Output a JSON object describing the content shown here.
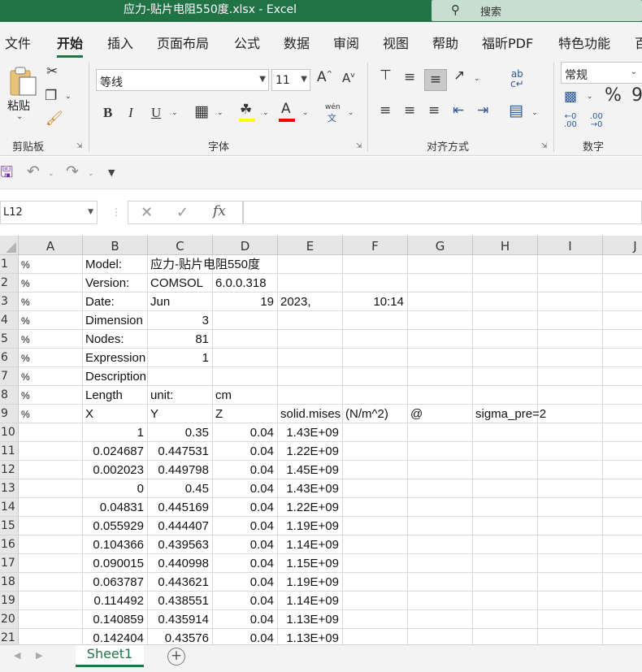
{
  "title": "应力-贴片电阻550度.xlsx  -  Excel",
  "search_placeholder": "搜索",
  "tabs": [
    "文件",
    "开始",
    "插入",
    "页面布局",
    "公式",
    "数据",
    "审阅",
    "视图",
    "帮助",
    "福昕PDF",
    "特色功能",
    "百"
  ],
  "ribbon": {
    "clipboard": {
      "label": "剪贴板",
      "paste": "粘贴"
    },
    "font": {
      "label": "字体",
      "font_name": "等线",
      "font_size": "11",
      "bold": "B",
      "italic": "I",
      "underline": "U",
      "phonetic_top": "wén",
      "phonetic_bottom": "文"
    },
    "alignment": {
      "label": "对齐方式"
    },
    "number": {
      "label": "数字",
      "format": "常规"
    }
  },
  "name_box": "L12",
  "formula_content": "",
  "columns": [
    "A",
    "B",
    "C",
    "D",
    "E",
    "F",
    "G",
    "H",
    "I",
    "J"
  ],
  "rows": [
    {
      "n": "1",
      "cells": {
        "A": "%",
        "B": "Model:",
        "C": "应力-贴片电阻550度"
      }
    },
    {
      "n": "2",
      "cells": {
        "A": "%",
        "B": "Version:",
        "C": "COMSOL",
        "D": "6.0.0.318"
      }
    },
    {
      "n": "3",
      "cells": {
        "A": "%",
        "B": "Date:",
        "C": "Jun",
        "D": "19",
        "E": "2023,",
        "F": "10:14"
      }
    },
    {
      "n": "4",
      "cells": {
        "A": "%",
        "B": "Dimension",
        "C": "3"
      }
    },
    {
      "n": "5",
      "cells": {
        "A": "%",
        "B": "Nodes:",
        "C": "81"
      }
    },
    {
      "n": "6",
      "cells": {
        "A": "%",
        "B": "Expression",
        "C": "1"
      }
    },
    {
      "n": "7",
      "cells": {
        "A": "%",
        "B": "Description:"
      }
    },
    {
      "n": "8",
      "cells": {
        "A": "%",
        "B": "Length",
        "C": "unit:",
        "D": "cm"
      }
    },
    {
      "n": "9",
      "cells": {
        "A": "%",
        "B": "X",
        "C": "Y",
        "D": "Z",
        "E": "solid.mises",
        "F": "(N/m^2)",
        "G": "@",
        "H": "sigma_pre=2"
      }
    },
    {
      "n": "10",
      "cells": {
        "B": "1",
        "C": "0.35",
        "D": "0.04",
        "E": "1.43E+09"
      }
    },
    {
      "n": "11",
      "cells": {
        "B": "0.024687",
        "C": "0.447531",
        "D": "0.04",
        "E": "1.22E+09"
      }
    },
    {
      "n": "12",
      "cells": {
        "B": "0.002023",
        "C": "0.449798",
        "D": "0.04",
        "E": "1.45E+09"
      }
    },
    {
      "n": "13",
      "cells": {
        "B": "0",
        "C": "0.45",
        "D": "0.04",
        "E": "1.43E+09"
      }
    },
    {
      "n": "14",
      "cells": {
        "B": "0.04831",
        "C": "0.445169",
        "D": "0.04",
        "E": "1.22E+09"
      }
    },
    {
      "n": "15",
      "cells": {
        "B": "0.055929",
        "C": "0.444407",
        "D": "0.04",
        "E": "1.19E+09"
      }
    },
    {
      "n": "16",
      "cells": {
        "B": "0.104366",
        "C": "0.439563",
        "D": "0.04",
        "E": "1.14E+09"
      }
    },
    {
      "n": "17",
      "cells": {
        "B": "0.090015",
        "C": "0.440998",
        "D": "0.04",
        "E": "1.15E+09"
      }
    },
    {
      "n": "18",
      "cells": {
        "B": "0.063787",
        "C": "0.443621",
        "D": "0.04",
        "E": "1.19E+09"
      }
    },
    {
      "n": "19",
      "cells": {
        "B": "0.114492",
        "C": "0.438551",
        "D": "0.04",
        "E": "1.14E+09"
      }
    },
    {
      "n": "20",
      "cells": {
        "B": "0.140859",
        "C": "0.435914",
        "D": "0.04",
        "E": "1.13E+09"
      }
    },
    {
      "n": "21",
      "cells": {
        "B": "0.142404",
        "C": "0.43576",
        "D": "0.04",
        "E": "1.13E+09"
      }
    }
  ],
  "sheet_tab": "Sheet1"
}
